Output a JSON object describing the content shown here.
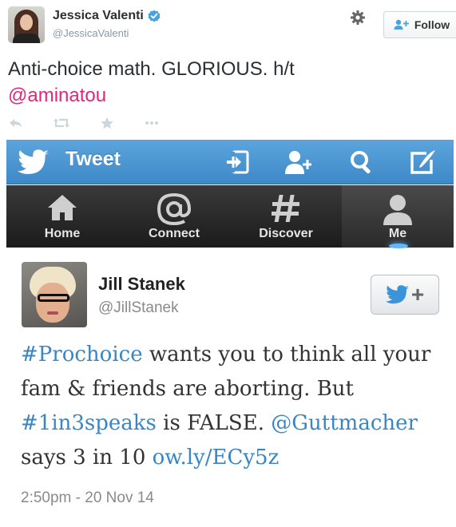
{
  "outer_tweet": {
    "author_name": "Jessica Valenti",
    "author_handle": "@JessicaValenti",
    "verified": true,
    "follow_label": "Follow",
    "text_main": "Anti-choice math. GLORIOUS. h/t",
    "text_mention": "@aminatou",
    "actions": [
      "reply-icon",
      "retweet-icon",
      "favorite-icon",
      "more-icon"
    ]
  },
  "embedded_screenshot": {
    "app_bar": {
      "title": "Tweet",
      "icons": [
        "sign-in-icon",
        "add-user-icon",
        "search-icon",
        "compose-icon"
      ]
    },
    "tabs": [
      {
        "label": "Home",
        "icon": "home-icon"
      },
      {
        "label": "Connect",
        "icon": "at-icon"
      },
      {
        "label": "Discover",
        "icon": "hashtag-icon"
      },
      {
        "label": "Me",
        "icon": "person-icon",
        "active": true
      }
    ],
    "tweet": {
      "author_name": "Jill Stanek",
      "author_handle": "@JillStanek",
      "segments": {
        "s1": "#Prochoice",
        "s2": " wants you to think all your fam & friends are aborting. But ",
        "s3": "#1in3speaks",
        "s4": " is FALSE. ",
        "s5": "@Guttmacher",
        "s6": " says 3 in 10 ",
        "s7": "ow.ly/ECy5z"
      },
      "timestamp": "2:50pm - 20 Nov 14"
    }
  },
  "colors": {
    "mention": "#e0267d",
    "link": "#3b86c2",
    "app_bar": "#4a96d2",
    "tab_bar": "#262626",
    "verified": "#4aa3df"
  }
}
